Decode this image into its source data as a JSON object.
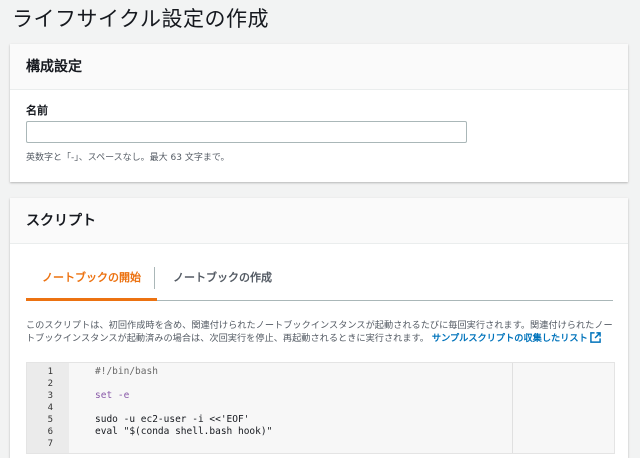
{
  "page": {
    "title": "ライフサイクル設定の作成"
  },
  "config": {
    "heading": "構成設定",
    "name_label": "名前",
    "name_value": "",
    "name_hint": "英数字と「-」、スペースなし。最大 63 文字まで。"
  },
  "script": {
    "heading": "スクリプト",
    "tabs": [
      {
        "label": "ノートブックの開始",
        "active": true
      },
      {
        "label": "ノートブックの作成",
        "active": false
      }
    ],
    "description": "このスクリプトは、初回作成時を含め、関連付けられたノートブックインスタンスが起動されるたびに毎回実行されます。関連付けられたノートブックインスタンスが起動済みの場合は、次回実行を停止、再起動されるときに実行されます。",
    "sample_link": "サンプルスクリプトの収集したリスト",
    "code_lines": [
      {
        "n": "1",
        "text": "#!/bin/bash"
      },
      {
        "n": "2",
        "text": ""
      },
      {
        "n": "3",
        "text": "set -e"
      },
      {
        "n": "4",
        "text": ""
      },
      {
        "n": "5",
        "text": "sudo -u ec2-user -i <<'EOF'"
      },
      {
        "n": "6",
        "text": "eval \"$(conda shell.bash hook)\""
      },
      {
        "n": "7",
        "text": ""
      }
    ]
  },
  "colors": {
    "accent": "#ec7211",
    "link": "#0073bb"
  }
}
